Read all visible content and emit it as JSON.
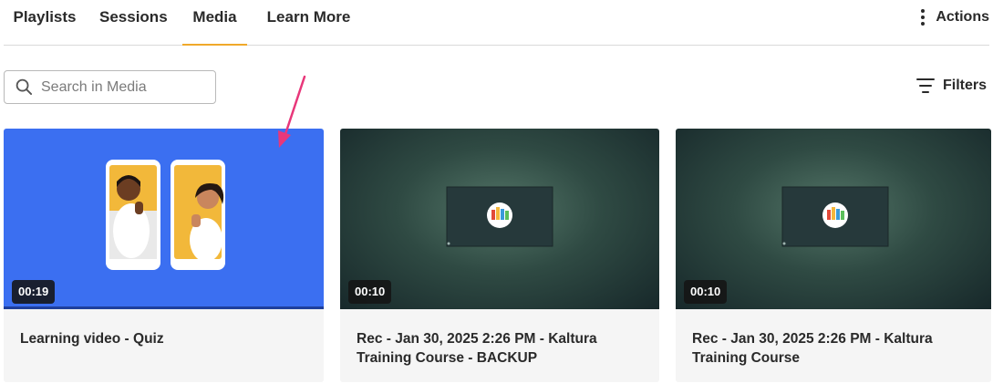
{
  "tabs": [
    {
      "label": "Playlists",
      "active": false
    },
    {
      "label": "Sessions",
      "active": false
    },
    {
      "label": "Media",
      "active": true
    },
    {
      "label": "Learn More",
      "active": false
    }
  ],
  "actions": {
    "label": "Actions",
    "icon": "more-vertical-icon"
  },
  "search": {
    "placeholder": "Search in Media",
    "value": "",
    "icon": "search-icon"
  },
  "filters": {
    "label": "Filters",
    "icon": "filter-lines-icon"
  },
  "colors": {
    "accent": "#f0a92a",
    "arrow": "#e8377a",
    "thumb_blue": "#3b6ff1"
  },
  "media": [
    {
      "title": "Learning video - Quiz",
      "duration": "00:19"
    },
    {
      "title": "Rec - Jan 30, 2025 2:26 PM - Kaltura Training Course - BACKUP",
      "duration": "00:10"
    },
    {
      "title": "Rec - Jan 30, 2025 2:26 PM - Kaltura Training Course",
      "duration": "00:10"
    }
  ]
}
